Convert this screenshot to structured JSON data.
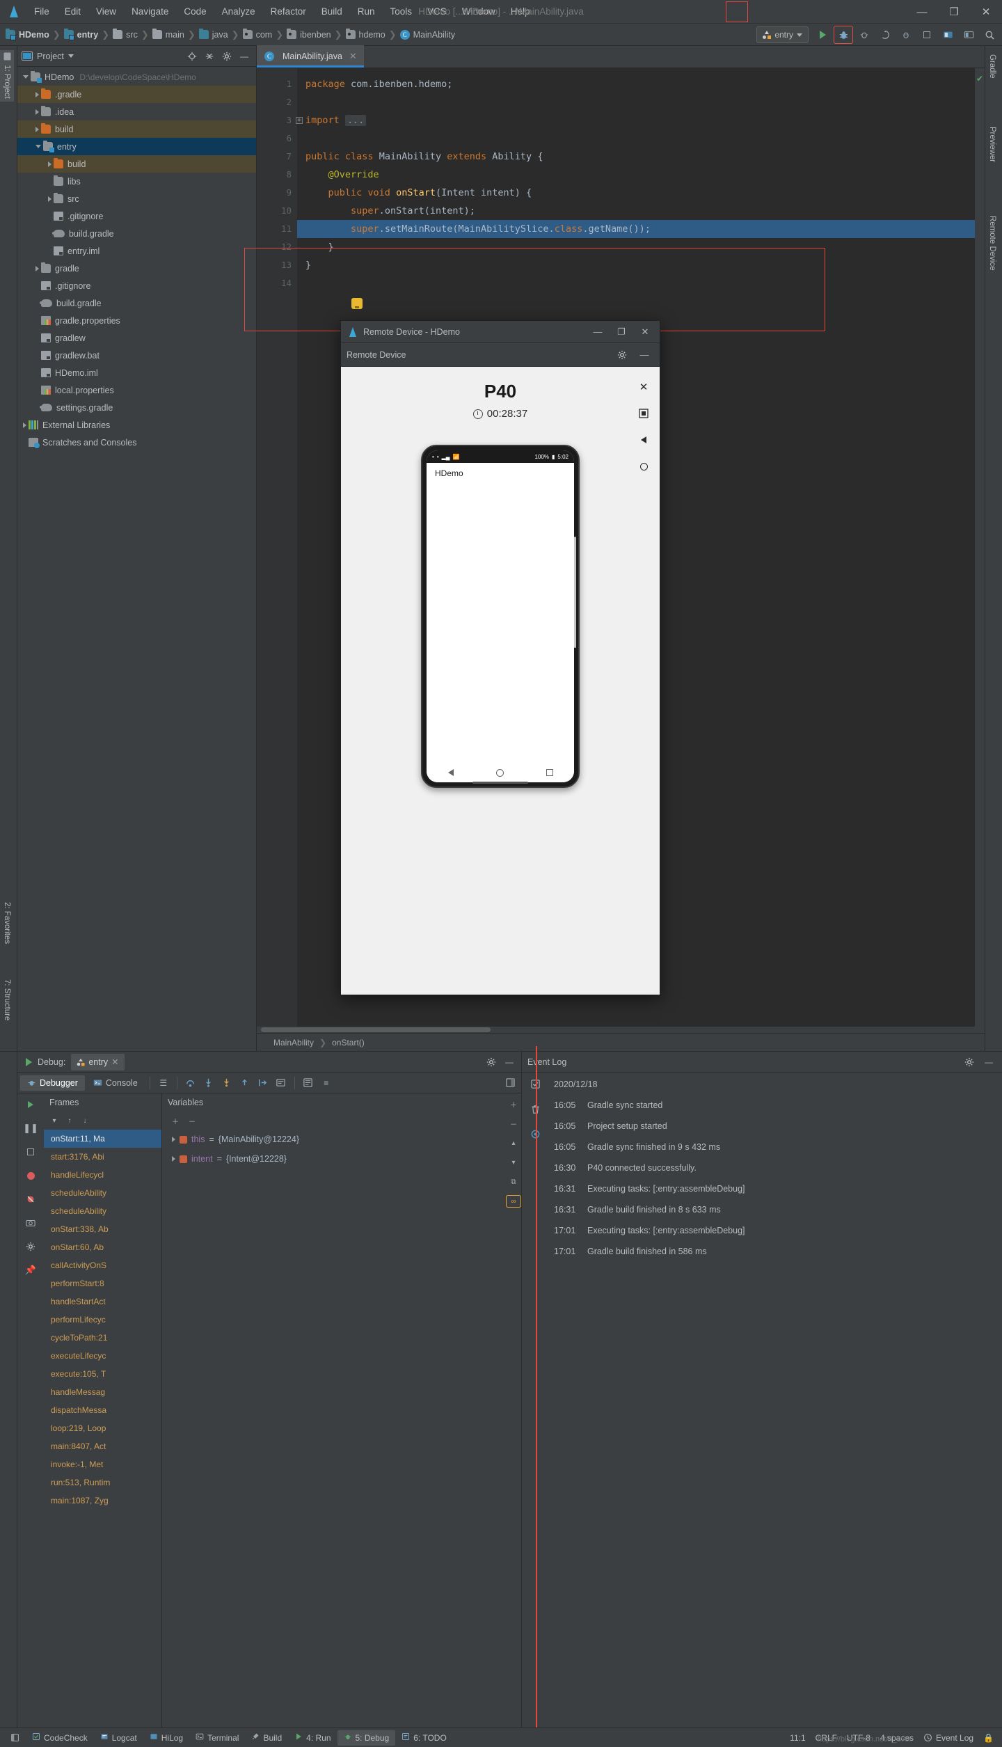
{
  "window": {
    "title": "HDemo [...\\HDemo] - ...\\MainAbility.java",
    "minimize": "—",
    "maximize": "❐",
    "close": "✕"
  },
  "menubar": {
    "items": [
      "File",
      "Edit",
      "View",
      "Navigate",
      "Code",
      "Analyze",
      "Refactor",
      "Build",
      "Run",
      "Tools",
      "VCS",
      "Window",
      "Help"
    ]
  },
  "breadcrumb": {
    "items": [
      {
        "label": "HDemo",
        "icon": "module-folder-icon"
      },
      {
        "label": "entry",
        "icon": "module-folder-icon"
      },
      {
        "label": "src",
        "icon": "folder-icon"
      },
      {
        "label": "main",
        "icon": "folder-icon"
      },
      {
        "label": "java",
        "icon": "source-folder-icon"
      },
      {
        "label": "com",
        "icon": "package-icon"
      },
      {
        "label": "ibenben",
        "icon": "package-icon"
      },
      {
        "label": "hdemo",
        "icon": "package-icon"
      },
      {
        "label": "MainAbility",
        "icon": "java-class-icon"
      }
    ]
  },
  "toolbar": {
    "run_config": "entry",
    "run_label": "Run",
    "debug_label": "Debug",
    "attach_label": "Attach Debugger",
    "coverage_label": "Run with Coverage",
    "profile_label": "Profile",
    "stop_label": "Stop",
    "previewer_label": "Previewer",
    "layout_label": "Layout Inspector",
    "search_label": "Search Everywhere"
  },
  "project_panel": {
    "title": "Project",
    "actions": [
      "locate-icon",
      "collapse-all-icon",
      "settings-icon",
      "hide-icon"
    ],
    "tree": [
      {
        "label": "HDemo",
        "path": "D:\\develop\\CodeSpace\\HDemo",
        "indent": 0,
        "twisty": "open",
        "icon": "module-folder-icon",
        "state": "none"
      },
      {
        "label": ".gradle",
        "path": "",
        "indent": 1,
        "twisty": "closed",
        "icon": "folder-orange-icon",
        "state": "bm"
      },
      {
        "label": ".idea",
        "path": "",
        "indent": 1,
        "twisty": "closed",
        "icon": "folder-grey-icon",
        "state": "none"
      },
      {
        "label": "build",
        "path": "",
        "indent": 1,
        "twisty": "closed",
        "icon": "folder-orange-icon",
        "state": "bm"
      },
      {
        "label": "entry",
        "path": "",
        "indent": 1,
        "twisty": "open",
        "icon": "module-folder-icon",
        "state": "sel"
      },
      {
        "label": "build",
        "path": "",
        "indent": 2,
        "twisty": "closed",
        "icon": "folder-orange-icon",
        "state": "bm"
      },
      {
        "label": "libs",
        "path": "",
        "indent": 2,
        "twisty": "none",
        "icon": "folder-grey-icon",
        "state": "none"
      },
      {
        "label": "src",
        "path": "",
        "indent": 2,
        "twisty": "closed",
        "icon": "folder-grey-icon",
        "state": "none"
      },
      {
        "label": ".gitignore",
        "path": "",
        "indent": 2,
        "twisty": "none",
        "icon": "gitignore-file-icon",
        "state": "none"
      },
      {
        "label": "build.gradle",
        "path": "",
        "indent": 2,
        "twisty": "none",
        "icon": "gradle-file-icon",
        "state": "none"
      },
      {
        "label": "entry.iml",
        "path": "",
        "indent": 2,
        "twisty": "none",
        "icon": "iml-file-icon",
        "state": "none"
      },
      {
        "label": "gradle",
        "path": "",
        "indent": 1,
        "twisty": "closed",
        "icon": "folder-grey-icon",
        "state": "none"
      },
      {
        "label": ".gitignore",
        "path": "",
        "indent": 1,
        "twisty": "none",
        "icon": "gitignore-file-icon",
        "state": "none"
      },
      {
        "label": "build.gradle",
        "path": "",
        "indent": 1,
        "twisty": "none",
        "icon": "gradle-file-icon",
        "state": "none"
      },
      {
        "label": "gradle.properties",
        "path": "",
        "indent": 1,
        "twisty": "none",
        "icon": "properties-file-icon",
        "state": "none"
      },
      {
        "label": "gradlew",
        "path": "",
        "indent": 1,
        "twisty": "none",
        "icon": "file-icon",
        "state": "none"
      },
      {
        "label": "gradlew.bat",
        "path": "",
        "indent": 1,
        "twisty": "none",
        "icon": "file-icon",
        "state": "none"
      },
      {
        "label": "HDemo.iml",
        "path": "",
        "indent": 1,
        "twisty": "none",
        "icon": "iml-file-icon",
        "state": "none"
      },
      {
        "label": "local.properties",
        "path": "",
        "indent": 1,
        "twisty": "none",
        "icon": "properties-file-icon",
        "state": "none"
      },
      {
        "label": "settings.gradle",
        "path": "",
        "indent": 1,
        "twisty": "none",
        "icon": "gradle-file-icon",
        "state": "none"
      },
      {
        "label": "External Libraries",
        "path": "",
        "indent": 0,
        "twisty": "closed",
        "icon": "libraries-icon",
        "state": "none"
      },
      {
        "label": "Scratches and Consoles",
        "path": "",
        "indent": 0,
        "twisty": "none",
        "icon": "scratches-icon",
        "state": "none"
      }
    ]
  },
  "left_strip": {
    "project_tab": "1: Project",
    "favorites_tab": "2: Favorites",
    "structure_tab": "7: Structure"
  },
  "right_strip": {
    "gradle_tab": "Gradle",
    "previewer_tab": "Previewer",
    "remote_device_tab": "Remote Device"
  },
  "editor": {
    "tab": {
      "label": "MainAbility.java",
      "close": "✕"
    },
    "lines": [
      {
        "num": "1",
        "text": "package com.ibenben.hdemo;"
      },
      {
        "num": "2",
        "text": ""
      },
      {
        "num": "3",
        "text": "import ..."
      },
      {
        "num": "6",
        "text": ""
      },
      {
        "num": "7",
        "text": "public class MainAbility extends Ability {"
      },
      {
        "num": "8",
        "text": "    @Override"
      },
      {
        "num": "9",
        "text": "    public void onStart(Intent intent) {"
      },
      {
        "num": "10",
        "text": "        super.onStart(intent);"
      },
      {
        "num": "11",
        "text": "        super.setMainRoute(MainAbilitySlice.class.getName());"
      },
      {
        "num": "12",
        "text": "    }"
      },
      {
        "num": "13",
        "text": "}"
      },
      {
        "num": "14",
        "text": ""
      }
    ],
    "current_line": "11",
    "breadcrumb_bottom": [
      "MainAbility",
      "onStart()"
    ],
    "inspection_status": "ok"
  },
  "remote_device": {
    "window_title": "Remote Device - HDemo",
    "panel_title": "Remote Device",
    "device_name": "P40",
    "timer": "00:28:37",
    "minimize": "—",
    "maximize": "❐",
    "close": "✕",
    "settings_icon": "gear-icon",
    "hide_icon": "minus-icon",
    "side_tools": [
      "close-session-icon",
      "screenshot-icon",
      "back-icon",
      "home-icon"
    ],
    "phone": {
      "status_battery": "100%",
      "status_time": "5:02",
      "app_title": "HDemo",
      "nav": [
        "back-triangle",
        "home-circle",
        "recents-square"
      ]
    }
  },
  "debug_panel": {
    "label": "Debug:",
    "config_name": "entry",
    "close": "✕",
    "tabs": [
      {
        "label": "Debugger",
        "selected": true,
        "icon": "debugger-icon"
      },
      {
        "label": "Console",
        "selected": false,
        "icon": "console-icon"
      }
    ],
    "toolbar_icons": [
      "show-frames-icon",
      "step-over-icon",
      "step-into-icon",
      "force-step-into-icon",
      "step-out-icon",
      "run-to-cursor-icon",
      "evaluate-icon",
      "watches-icon",
      "mute-breakpoints-icon",
      "settings-icon"
    ],
    "frames_header": "Frames",
    "variables_header": "Variables",
    "frames": [
      {
        "label": "onStart:11, Ma",
        "selected": true
      },
      {
        "label": "start:3176, Abi",
        "selected": false
      },
      {
        "label": "handleLifecycl",
        "selected": false
      },
      {
        "label": "scheduleAbility",
        "selected": false
      },
      {
        "label": "scheduleAbility",
        "selected": false
      },
      {
        "label": "onStart:338, Ab",
        "selected": false
      },
      {
        "label": "onStart:60, Ab",
        "selected": false
      },
      {
        "label": "callActivityOnS",
        "selected": false
      },
      {
        "label": "performStart:8",
        "selected": false
      },
      {
        "label": "handleStartAct",
        "selected": false
      },
      {
        "label": "performLifecyc",
        "selected": false
      },
      {
        "label": "cycleToPath:21",
        "selected": false
      },
      {
        "label": "executeLifecyc",
        "selected": false
      },
      {
        "label": "execute:105, T",
        "selected": false
      },
      {
        "label": "handleMessag",
        "selected": false
      },
      {
        "label": "dispatchMessa",
        "selected": false
      },
      {
        "label": "loop:219, Loop",
        "selected": false
      },
      {
        "label": "main:8407, Act",
        "selected": false
      },
      {
        "label": "invoke:-1, Met",
        "selected": false
      },
      {
        "label": "run:513, Runtim",
        "selected": false
      },
      {
        "label": "main:1087, Zyg",
        "selected": false
      }
    ],
    "variables": [
      {
        "name": "this",
        "eq": "=",
        "value": "{MainAbility@12224}"
      },
      {
        "name": "intent",
        "eq": "=",
        "value": "{Intent@12228}"
      }
    ]
  },
  "event_log": {
    "title": "Event Log",
    "settings_icon": "gear-icon",
    "hide_icon": "minus-icon",
    "gutter_icons": [
      "mark-read-icon",
      "clear-all-icon",
      "settings-icon"
    ],
    "date": "2020/12/18",
    "entries": [
      {
        "time": "16:05",
        "message": "Gradle sync started"
      },
      {
        "time": "16:05",
        "message": "Project setup started"
      },
      {
        "time": "16:05",
        "message": "Gradle sync finished in 9 s 432 ms"
      },
      {
        "time": "16:30",
        "message": "P40 connected successfully."
      },
      {
        "time": "16:31",
        "message": "Executing tasks: [:entry:assembleDebug]"
      },
      {
        "time": "16:31",
        "message": "Gradle build finished in 8 s 633 ms"
      },
      {
        "time": "17:01",
        "message": "Executing tasks: [:entry:assembleDebug]"
      },
      {
        "time": "17:01",
        "message": "Gradle build finished in 586 ms"
      }
    ]
  },
  "statusbar": {
    "items": [
      {
        "label": "CodeCheck",
        "icon": "codecheck-icon",
        "selected": false
      },
      {
        "label": "Logcat",
        "icon": "logcat-icon",
        "selected": false
      },
      {
        "label": "HiLog",
        "icon": "hilog-icon",
        "selected": false
      },
      {
        "label": "Terminal",
        "icon": "terminal-icon",
        "selected": false
      },
      {
        "label": "Build",
        "icon": "build-icon",
        "selected": false
      },
      {
        "label": "4: Run",
        "icon": "run-icon",
        "selected": false
      },
      {
        "label": "5: Debug",
        "icon": "debug-icon",
        "selected": true
      },
      {
        "label": "6: TODO",
        "icon": "todo-icon",
        "selected": false
      }
    ],
    "caret": "11:1",
    "line_sep": "CRLF",
    "encoding": "UTF-8",
    "indent": "4 spaces",
    "event_log": "Event Log",
    "watermark": "https://blog.csdn.net/n_ever"
  },
  "colors": {
    "accent_blue": "#3592c4",
    "selection_blue": "#0d3a58",
    "current_line": "#2f5c87",
    "red_annotation": "#e04a3f",
    "keyword_orange": "#cc7832",
    "bookmark_olive": "#4e4833"
  }
}
